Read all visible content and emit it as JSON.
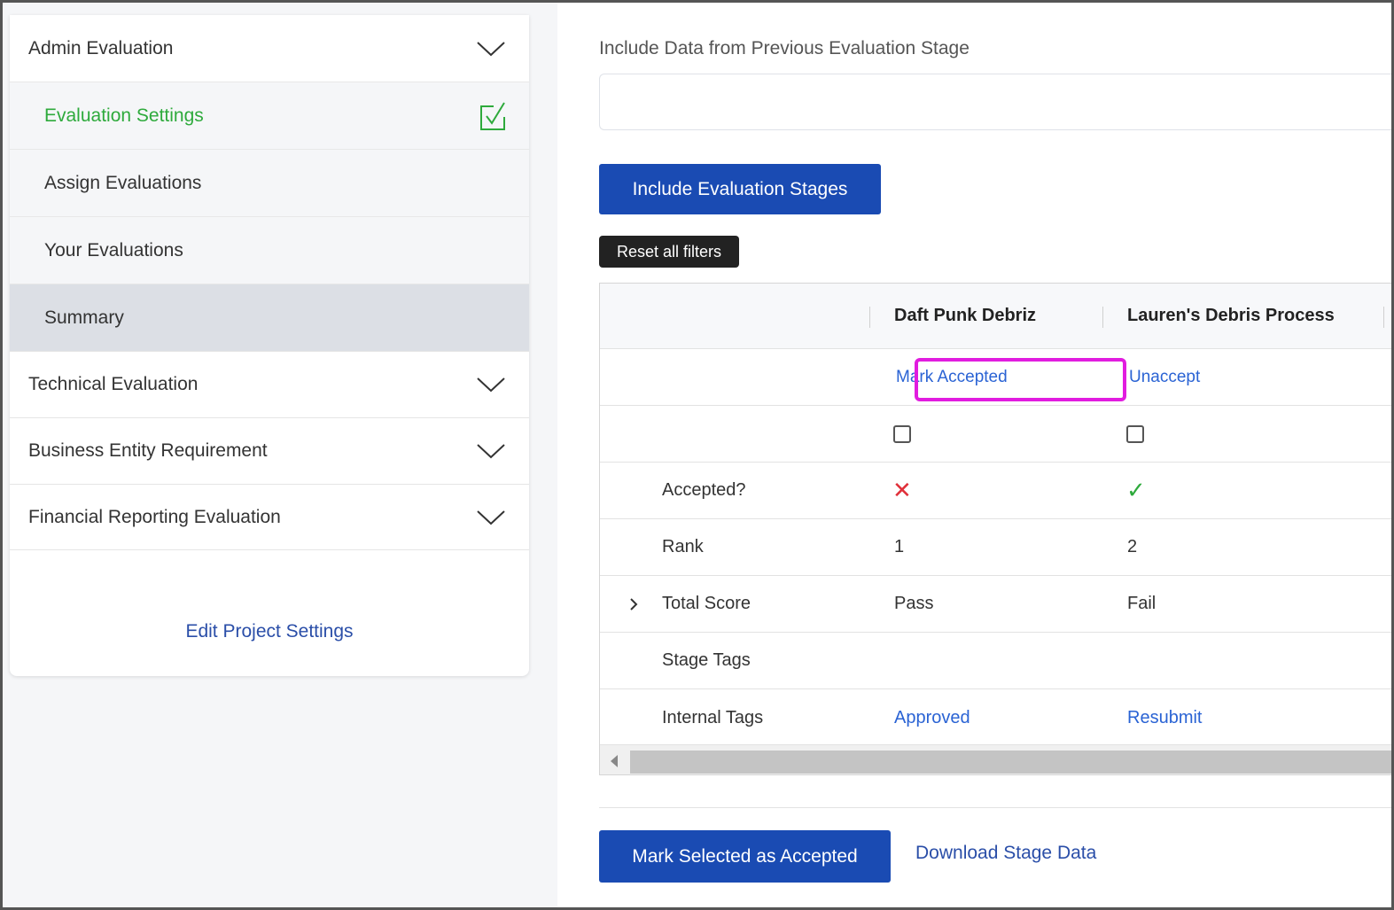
{
  "sidebar": {
    "sections": [
      {
        "label": "Admin Evaluation"
      },
      {
        "label": "Technical Evaluation"
      },
      {
        "label": "Business Entity Requirement"
      },
      {
        "label": "Financial Reporting Evaluation"
      }
    ],
    "sub_items": [
      {
        "label": "Evaluation Settings",
        "checked": true
      },
      {
        "label": "Assign Evaluations"
      },
      {
        "label": "Your Evaluations"
      },
      {
        "label": "Summary",
        "selected": true
      }
    ],
    "edit_link": "Edit Project Settings"
  },
  "main": {
    "include_label": "Include Data from Previous Evaluation Stage",
    "include_value": "",
    "include_button": "Include Evaluation Stages",
    "reset_button": "Reset all filters",
    "table": {
      "columns": [
        "Daft Punk Debriz",
        "Lauren's Debris Process"
      ],
      "actions": [
        "Mark Accepted",
        "Unaccept"
      ],
      "rows": [
        {
          "label": "Accepted?",
          "values": [
            "✕",
            "✓"
          ]
        },
        {
          "label": "Rank",
          "values": [
            "1",
            "2"
          ]
        },
        {
          "label": "Total Score",
          "values": [
            "Pass",
            "Fail"
          ]
        },
        {
          "label": "Stage Tags",
          "values": [
            "",
            ""
          ]
        },
        {
          "label": "Internal Tags",
          "values": [
            "Approved",
            "Resubmit"
          ]
        }
      ]
    },
    "mark_selected_button": "Mark Selected as Accepted",
    "download_link": "Download Stage Data"
  },
  "colors": {
    "primary": "#1a4bb3",
    "link": "#2a63d4",
    "success": "#2eaa3c",
    "danger": "#e0303a",
    "highlight": "#e11cdf"
  }
}
